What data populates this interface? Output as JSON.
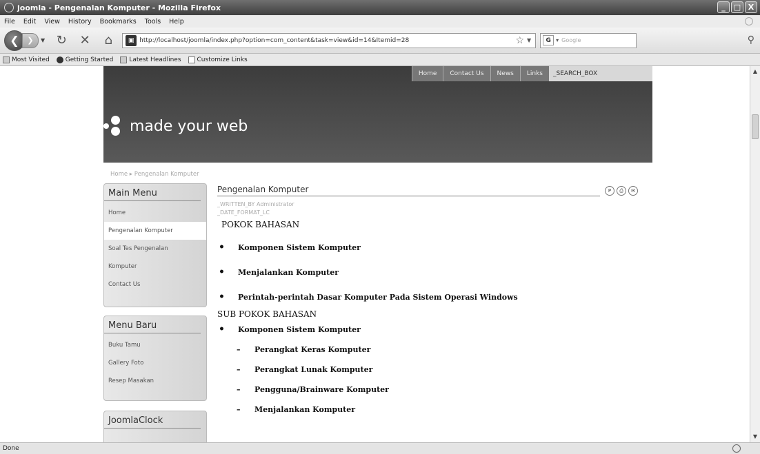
{
  "window": {
    "title": "joomla - Pengenalan Komputer - Mozilla Firefox",
    "buttons": [
      "_",
      "□",
      "X"
    ]
  },
  "menu": [
    "File",
    "Edit",
    "View",
    "History",
    "Bookmarks",
    "Tools",
    "Help"
  ],
  "nav": {
    "back_icon": "back-arrow-icon",
    "forward_icon": "forward-arrow-icon",
    "url": "http://localhost/joomla/index.php?option=com_content&task=view&id=14&Itemid=28",
    "search_placeholder": "Google"
  },
  "bookmarks": [
    "Most Visited",
    "Getting Started",
    "Latest Headlines",
    "Customize Links"
  ],
  "site": {
    "topnav": [
      "Home",
      "Contact Us",
      "News",
      "Links"
    ],
    "search_box": "_SEARCH_BOX",
    "brand": "made your web",
    "breadcrumb": "Home ▸ Pengenalan Komputer"
  },
  "modules": [
    {
      "title": "Main Menu",
      "items": [
        "Home",
        "Pengenalan Komputer",
        "Soal Tes Pengenalan",
        "Komputer",
        "Contact Us"
      ],
      "active_index": 1
    },
    {
      "title": "Menu Baru",
      "items": [
        "Buku Tamu",
        "Gallery Foto",
        "Resep Masakan"
      ]
    },
    {
      "title": "JoomlaClock",
      "items": []
    }
  ],
  "article": {
    "title": "Pengenalan Komputer",
    "written_by": "_WRITTEN_BY Administrator",
    "date_format": "_DATE_FORMAT_LC",
    "heading1": "POKOK BAHASAN",
    "bullets1": [
      "Komponen Sistem Komputer",
      "Menjalankan Komputer",
      "Perintah-perintah Dasar Komputer Pada Sistem Operasi Windows"
    ],
    "heading2": "SUB POKOK BAHASAN",
    "sub_bullet": "Komponen Sistem Komputer",
    "dash_items": [
      "Perangkat Keras Komputer",
      "Perangkat Lunak Komputer",
      "Pengguna/Brainware Komputer",
      "Menjalankan Komputer"
    ]
  },
  "status": {
    "text": "Done"
  }
}
